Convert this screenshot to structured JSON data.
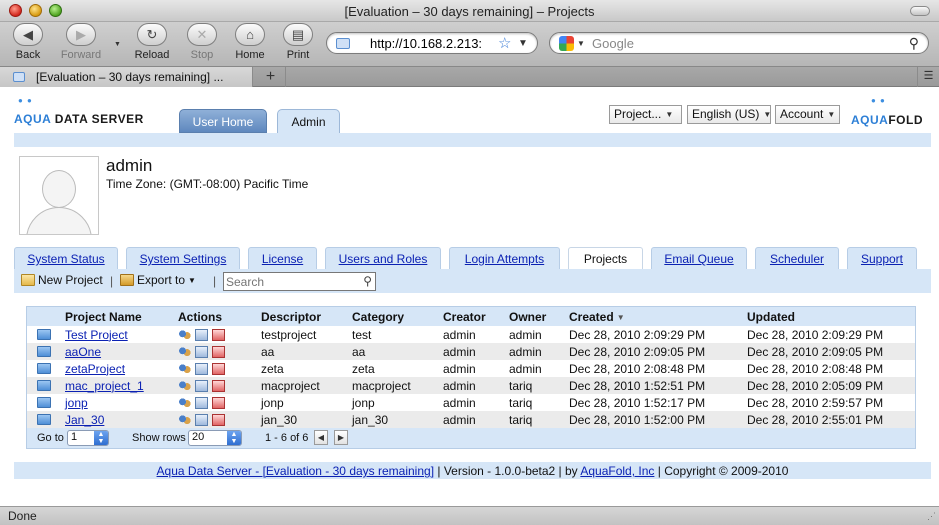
{
  "window": {
    "title": "[Evaluation – 30 days remaining] – Projects"
  },
  "toolbar": {
    "back_label": "Back",
    "forward_label": "Forward",
    "reload_label": "Reload",
    "stop_label": "Stop",
    "home_label": "Home",
    "print_label": "Print"
  },
  "address": {
    "url": "http://10.168.2.213:"
  },
  "websearch": {
    "placeholder": "Google"
  },
  "browser_tab": {
    "title": "[Evaluation – 30 days remaining] ...",
    "new_tab_label": "+"
  },
  "app": {
    "logo_left": {
      "aqua": "AQUA",
      "data_server": "DATA SERVER"
    },
    "logo_right": {
      "aqua": "AQUA",
      "fold": "FOLD"
    },
    "nav": {
      "user_home": "User Home",
      "admin": "Admin"
    },
    "selectors": {
      "project": "Project...",
      "language": "English (US)",
      "account": "Account"
    }
  },
  "profile": {
    "username": "admin",
    "timezone": "Time Zone: (GMT:-08:00) Pacific Time"
  },
  "admin_tabs": [
    {
      "label": "System Status",
      "active": false
    },
    {
      "label": "System Settings",
      "active": false
    },
    {
      "label": "License",
      "active": false
    },
    {
      "label": "Users and Roles",
      "active": false
    },
    {
      "label": "Login Attempts",
      "active": false
    },
    {
      "label": "Projects",
      "active": true
    },
    {
      "label": "Email Queue",
      "active": false
    },
    {
      "label": "Scheduler",
      "active": false
    },
    {
      "label": "Support",
      "active": false
    }
  ],
  "actions": {
    "new_project": "New Project",
    "export_to": "Export to",
    "separator": "|",
    "search_placeholder": "Search"
  },
  "grid": {
    "columns": [
      "Project Name",
      "Actions",
      "Descriptor",
      "Category",
      "Creator",
      "Owner",
      "Created",
      "Updated"
    ],
    "rows": [
      {
        "name": "Test Project",
        "descriptor": "testproject",
        "category": "test",
        "creator": "admin",
        "owner": "admin",
        "created": "Dec 28, 2010 2:09:29 PM",
        "updated": "Dec 28, 2010 2:09:29 PM"
      },
      {
        "name": "aaOne",
        "descriptor": "aa",
        "category": "aa",
        "creator": "admin",
        "owner": "admin",
        "created": "Dec 28, 2010 2:09:05 PM",
        "updated": "Dec 28, 2010 2:09:05 PM"
      },
      {
        "name": "zetaProject",
        "descriptor": "zeta",
        "category": "zeta",
        "creator": "admin",
        "owner": "admin",
        "created": "Dec 28, 2010 2:08:48 PM",
        "updated": "Dec 28, 2010 2:08:48 PM"
      },
      {
        "name": "mac_project_1",
        "descriptor": "macproject",
        "category": "macproject",
        "creator": "admin",
        "owner": "tariq",
        "created": "Dec 28, 2010 1:52:51 PM",
        "updated": "Dec 28, 2010 2:05:09 PM"
      },
      {
        "name": "jonp",
        "descriptor": "jonp",
        "category": "jonp",
        "creator": "admin",
        "owner": "tariq",
        "created": "Dec 28, 2010 1:52:17 PM",
        "updated": "Dec 28, 2010 2:59:57 PM"
      },
      {
        "name": "Jan_30",
        "descriptor": "jan_30",
        "category": "jan_30",
        "creator": "admin",
        "owner": "tariq",
        "created": "Dec 28, 2010 1:52:00 PM",
        "updated": "Dec 28, 2010 2:55:01 PM"
      }
    ],
    "sorted_column": "Created"
  },
  "pager": {
    "goto_label": "Go to",
    "goto_value": "1",
    "show_rows_label": "Show rows",
    "show_rows_value": "20",
    "range": "1 - 6 of 6"
  },
  "footer": {
    "product_link": "Aqua Data Server - [Evaluation - 30 days remaining]",
    "version": " | Version - 1.0.0-beta2 | by ",
    "company_link": "AquaFold, Inc",
    "copyright": " | Copyright © 2009-2010"
  },
  "statusbar": {
    "text": "Done"
  },
  "colors": {
    "accent_band": "#d6e6f7",
    "link": "#0b21b3",
    "brand_blue": "#2d7fd6"
  },
  "icons": [
    "back-icon",
    "forward-icon",
    "reload-icon",
    "stop-icon",
    "home-icon",
    "print-icon",
    "bookmark-star-icon",
    "search-icon",
    "folder-icon",
    "users-icon",
    "edit-icon",
    "delete-icon"
  ]
}
